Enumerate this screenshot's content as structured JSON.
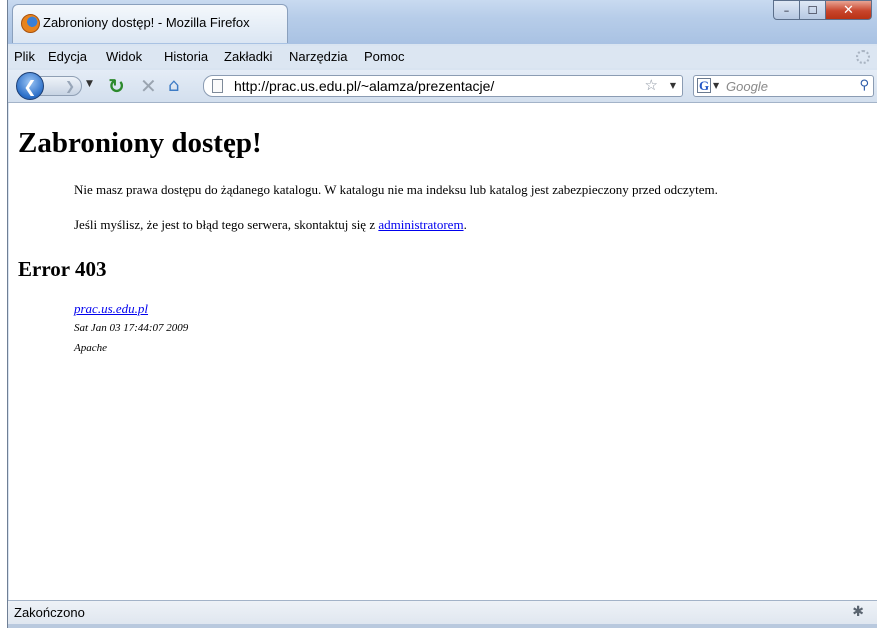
{
  "window": {
    "title": "Zabroniony dostęp! - Mozilla Firefox",
    "min_glyph": "–",
    "max_glyph": "☐",
    "close_glyph": "✕"
  },
  "menu": {
    "items": [
      "Plik",
      "Edycja",
      "Widok",
      "Historia",
      "Zakładki",
      "Narzędzia",
      "Pomoc"
    ]
  },
  "toolbar": {
    "back_glyph": "❮",
    "forward_glyph": "❯",
    "reload_glyph": "↻",
    "stop_glyph": "✕",
    "home_glyph": "⌂",
    "url": "http://prac.us.edu.pl/~alamza/prezentacje/",
    "bookmark_glyph": "☆",
    "search_placeholder": "Google",
    "search_engine_letter": "G",
    "search_go_glyph": "⚲"
  },
  "page": {
    "heading": "Zabroniony dostęp!",
    "para1": "Nie masz prawa dostępu do żądanego katalogu. W katalogu nie ma indeksu lub katalog jest zabezpieczony przed odczytem.",
    "para2_prefix": "Jeśli myślisz, że jest to błąd tego serwera, skontaktuj się z ",
    "para2_link": "administratorem",
    "para2_suffix": ".",
    "error_heading": "Error 403",
    "server_link": "prac.us.edu.pl",
    "date": "Sat Jan 03 17:44:07 2009",
    "server_software": "Apache"
  },
  "status": {
    "text": "Zakończono"
  },
  "icons": {
    "firefox": "firefox-logo-icon",
    "page": "page-icon",
    "addon_status": "bug-icon"
  }
}
